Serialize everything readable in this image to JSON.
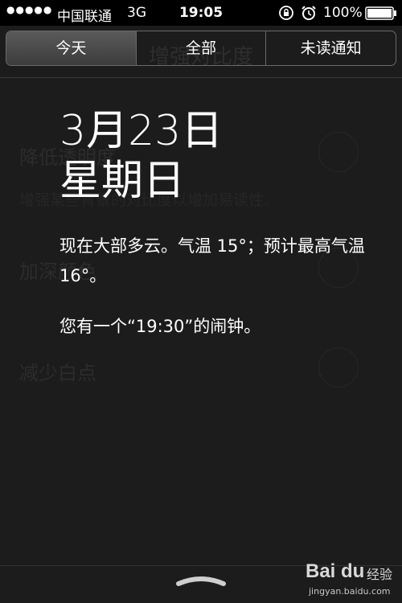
{
  "status_bar": {
    "signal_dots": "●●●●●",
    "carrier": "中国联通",
    "network": "3G",
    "time": "19:05",
    "battery_percent": "100%",
    "icons": [
      "rotation-lock-icon",
      "alarm-clock-icon",
      "battery-icon"
    ]
  },
  "tabs": [
    {
      "label": "今天",
      "active": true
    },
    {
      "label": "全部",
      "active": false
    },
    {
      "label": "未读通知",
      "active": false
    }
  ],
  "today": {
    "date": "3月23日",
    "weekday": "星期日",
    "weather": "现在大部多云。气温 15°；预计最高气温 16°。",
    "alarm": "您有一个“19:30”的闹钟。"
  },
  "background_screen": {
    "title": "增强对比度",
    "rows": [
      {
        "label": "降低透明度",
        "description": "增强某些背景的对比度以增加易读性。"
      },
      {
        "label": "加深颜色"
      },
      {
        "label": "减少白点"
      }
    ]
  },
  "watermark": {
    "logo": "Bai du",
    "name": "经验",
    "url": "jingyan.baidu.com"
  },
  "colors": {
    "background": "#1c1c1c",
    "text": "#ffffff",
    "segment_active": "#4a4a4a",
    "segment_border": "#6a6a6a"
  }
}
